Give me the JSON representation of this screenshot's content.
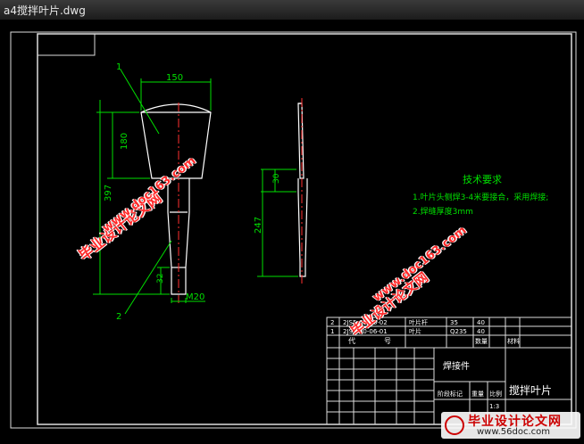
{
  "window": {
    "title": "a4搅拌叶片.dwg"
  },
  "drawing": {
    "dimensions": {
      "width_top": "150",
      "height_head": "180",
      "total_length": "397",
      "shaft_dim": "247",
      "thread_len": "32",
      "thread_size": "M20",
      "side_top": "30"
    },
    "balloons": {
      "one": "1",
      "two": "2"
    },
    "tech_requirements": {
      "title": "技术要求",
      "line1": "1.叶片头侧焊3-4米要接合，采用焊接;",
      "line2": "2.焊缝厚度3mm"
    },
    "bom": [
      {
        "no": "2",
        "code": "2JS5-00-06-02",
        "name": "叶片杆",
        "qty": "35",
        "mat": "40"
      },
      {
        "no": "1",
        "code": "2JS5-00-06-01",
        "name": "叶片",
        "qty": "Q235",
        "mat": "40"
      }
    ],
    "bom_header": {
      "col1": "代",
      "col2": "号",
      "col3": "数量",
      "col4": "材料"
    },
    "title_block": {
      "assembly": "焊接件",
      "part_name": "搅拌叶片",
      "scale_label": "比例",
      "scale_value": "1:3",
      "weight_label": "重量",
      "stage_label": "阶段标记"
    }
  },
  "watermarks": {
    "w1": "毕业设计论文网",
    "w2": "www.doc163.com"
  },
  "logo": {
    "name": "毕业设计论文网",
    "url": "www.56doc.com"
  }
}
